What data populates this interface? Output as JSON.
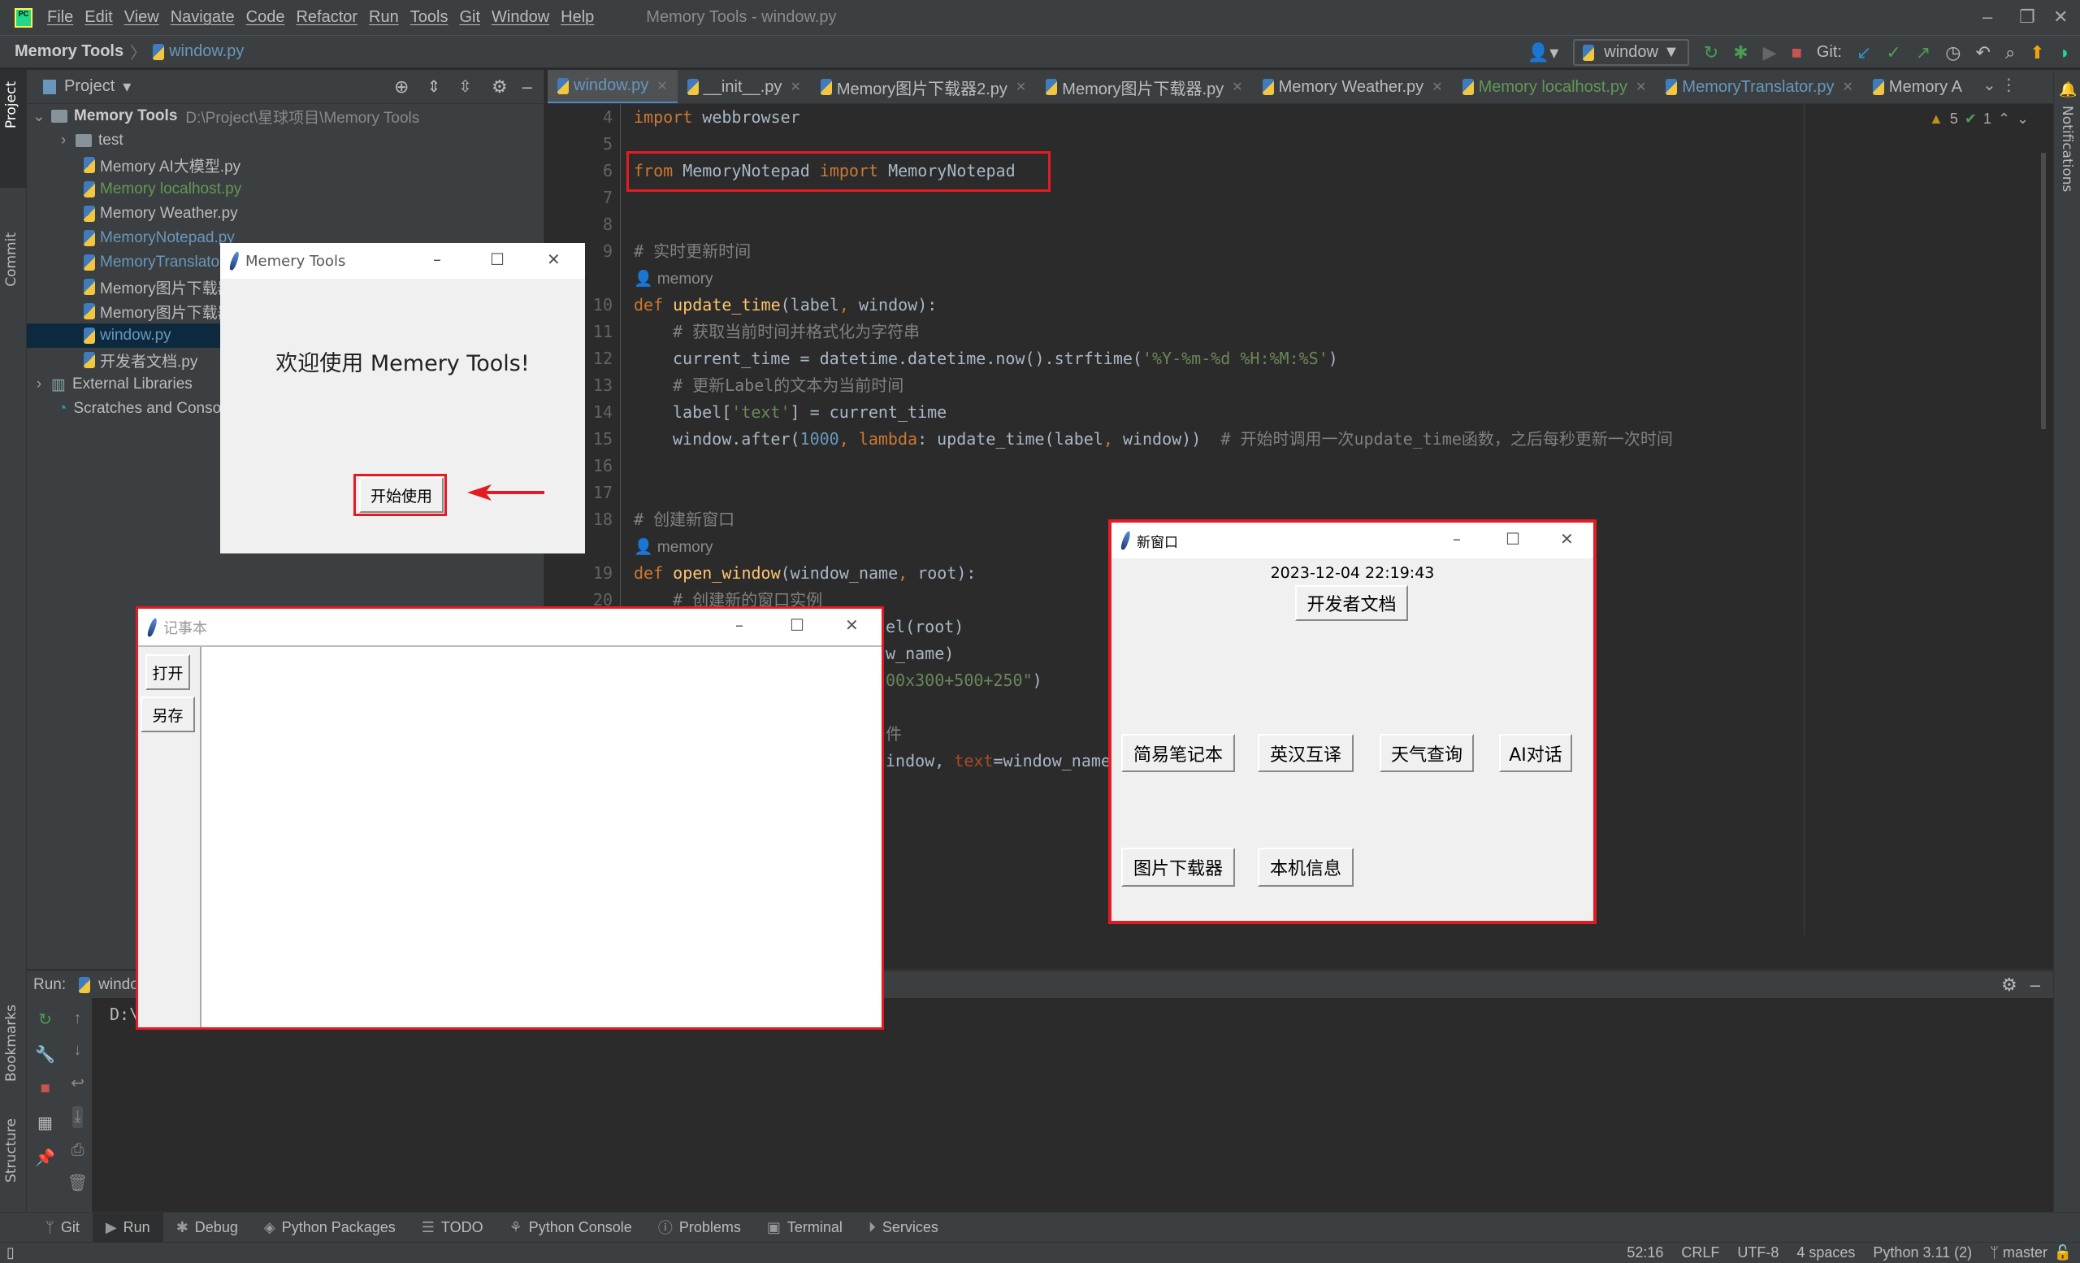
{
  "app": {
    "title": "Memory Tools - window.py",
    "menu": [
      "File",
      "Edit",
      "View",
      "Navigate",
      "Code",
      "Refactor",
      "Run",
      "Tools",
      "Git",
      "Window",
      "Help"
    ]
  },
  "breadcrumb": {
    "project": "Memory Tools",
    "file": "window.py"
  },
  "toolbar": {
    "run_config": "window",
    "git_label": "Git:"
  },
  "project_panel": {
    "title": "Project",
    "root": {
      "name": "Memory Tools",
      "path": "D:\\Project\\星球项目\\Memory Tools"
    },
    "items": [
      {
        "label": "test",
        "type": "folder",
        "color": "#bbbbbb"
      },
      {
        "label": "Memory AI大模型.py",
        "type": "file",
        "color": "#bbbbbb"
      },
      {
        "label": "Memory localhost.py",
        "type": "file",
        "color": "#629755"
      },
      {
        "label": "Memory Weather.py",
        "type": "file",
        "color": "#bbbbbb"
      },
      {
        "label": "MemoryNotepad.py",
        "type": "file",
        "color": "#6897bb"
      },
      {
        "label": "MemoryTranslator.py",
        "type": "file",
        "color": "#6897bb"
      },
      {
        "label": "Memory图片下载器2.py",
        "type": "file",
        "color": "#bbbbbb"
      },
      {
        "label": "Memory图片下载器.py",
        "type": "file",
        "color": "#bbbbbb"
      },
      {
        "label": "window.py",
        "type": "file",
        "color": "#6897bb",
        "selected": true
      },
      {
        "label": "开发者文档.py",
        "type": "file",
        "color": "#bbbbbb"
      },
      {
        "label": "External Libraries",
        "type": "lib",
        "color": "#bbbbbb"
      },
      {
        "label": "Scratches and Consoles",
        "type": "scratch",
        "color": "#bbbbbb"
      }
    ]
  },
  "editor_tabs": [
    {
      "label": "window.py",
      "color": "#6897bb",
      "active": true
    },
    {
      "label": "__init__.py",
      "color": "#bbbbbb"
    },
    {
      "label": "Memory图片下载器2.py",
      "color": "#bbbbbb"
    },
    {
      "label": "Memory图片下载器.py",
      "color": "#bbbbbb"
    },
    {
      "label": "Memory Weather.py",
      "color": "#bbbbbb"
    },
    {
      "label": "Memory localhost.py",
      "color": "#629755"
    },
    {
      "label": "MemoryTranslator.py",
      "color": "#6897bb"
    },
    {
      "label": "Memory A",
      "color": "#bbbbbb"
    }
  ],
  "inspections": {
    "warnings": "5",
    "ok": "1"
  },
  "code": [
    {
      "n": "4",
      "indent": 0,
      "tokens": [
        {
          "t": "import ",
          "k": "kw"
        },
        {
          "t": "webbrowser",
          "k": ""
        }
      ]
    },
    {
      "n": "5",
      "indent": 0,
      "tokens": []
    },
    {
      "n": "6",
      "indent": 0,
      "tokens": [
        {
          "t": "from ",
          "k": "kw"
        },
        {
          "t": "MemoryNotepad ",
          "k": ""
        },
        {
          "t": "import ",
          "k": "kw"
        },
        {
          "t": "MemoryNotepad",
          "k": ""
        }
      ]
    },
    {
      "n": "7",
      "indent": 0,
      "tokens": []
    },
    {
      "n": "8",
      "indent": 0,
      "tokens": []
    },
    {
      "n": "9",
      "indent": 0,
      "tokens": [
        {
          "t": "# 实时更新时间",
          "k": "cmt"
        }
      ]
    },
    {
      "n": "",
      "indent": 0,
      "tokens": [
        {
          "t": "👤 memory",
          "k": "inlay"
        }
      ]
    },
    {
      "n": "10",
      "indent": 0,
      "tokens": [
        {
          "t": "def ",
          "k": "kw"
        },
        {
          "t": "update_time",
          "k": "fn"
        },
        {
          "t": "(label",
          "k": ""
        },
        {
          "t": ", ",
          "k": "kw"
        },
        {
          "t": "window):",
          "k": ""
        }
      ]
    },
    {
      "n": "11",
      "indent": 1,
      "tokens": [
        {
          "t": "# 获取当前时间并格式化为字符串",
          "k": "cmt"
        }
      ]
    },
    {
      "n": "12",
      "indent": 1,
      "tokens": [
        {
          "t": "current_time = datetime.datetime.now().strftime(",
          "k": ""
        },
        {
          "t": "'%Y-%m-%d %H:%M:%S'",
          "k": "str"
        },
        {
          "t": ")",
          "k": ""
        }
      ]
    },
    {
      "n": "13",
      "indent": 1,
      "tokens": [
        {
          "t": "# 更新Label的文本为当前时间",
          "k": "cmt"
        }
      ]
    },
    {
      "n": "14",
      "indent": 1,
      "tokens": [
        {
          "t": "label[",
          "k": ""
        },
        {
          "t": "'text'",
          "k": "str"
        },
        {
          "t": "] = current_time",
          "k": ""
        }
      ]
    },
    {
      "n": "15",
      "indent": 1,
      "tokens": [
        {
          "t": "window.after(",
          "k": ""
        },
        {
          "t": "1000",
          "k": "num"
        },
        {
          "t": ", ",
          "k": "kw"
        },
        {
          "t": "lambda",
          "k": "kw"
        },
        {
          "t": ": update_time(label",
          "k": ""
        },
        {
          "t": ", ",
          "k": "kw"
        },
        {
          "t": "window))  ",
          "k": ""
        },
        {
          "t": "# 开始时调用一次update_time函数，之后每秒更新一次时间",
          "k": "cmt"
        }
      ]
    },
    {
      "n": "16",
      "indent": 0,
      "tokens": []
    },
    {
      "n": "17",
      "indent": 0,
      "tokens": []
    },
    {
      "n": "18",
      "indent": 0,
      "tokens": [
        {
          "t": "# 创建新窗口",
          "k": "cmt"
        }
      ]
    },
    {
      "n": "",
      "indent": 0,
      "tokens": [
        {
          "t": "👤 memory",
          "k": "inlay"
        }
      ]
    },
    {
      "n": "19",
      "indent": 0,
      "tokens": [
        {
          "t": "def ",
          "k": "kw"
        },
        {
          "t": "open_window",
          "k": "fn"
        },
        {
          "t": "(window_name",
          "k": ""
        },
        {
          "t": ", ",
          "k": "kw"
        },
        {
          "t": "root):",
          "k": ""
        }
      ]
    },
    {
      "n": "20",
      "indent": 1,
      "tokens": [
        {
          "t": "# 创建新的窗口实例",
          "k": "cmt"
        }
      ]
    },
    {
      "n": "21",
      "indent": 0,
      "frag": true,
      "tokens": [
        {
          "t": "el(root)",
          "k": ""
        }
      ]
    },
    {
      "n": "22",
      "indent": 0,
      "frag": true,
      "tokens": [
        {
          "t": "w_name)",
          "k": ""
        }
      ]
    },
    {
      "n": "23",
      "indent": 0,
      "frag": true,
      "tokens": [
        {
          "t": "00x300+500+250\"",
          "k": "str"
        },
        {
          "t": ")",
          "k": ""
        }
      ]
    },
    {
      "n": "24",
      "indent": 0,
      "tokens": []
    },
    {
      "n": "25",
      "indent": 0,
      "frag": true,
      "tokens": [
        {
          "t": "件",
          "k": "cmt"
        }
      ]
    },
    {
      "n": "26",
      "indent": 0,
      "frag": true,
      "tokens": [
        {
          "t": "indow, ",
          "k": ""
        },
        {
          "t": "text",
          "k": "param"
        },
        {
          "t": "=window_name",
          "k": ""
        }
      ]
    }
  ],
  "run_panel": {
    "label": "Run:",
    "tab": "window",
    "console": "D:\\"
  },
  "left_stripe": {
    "project": "Project",
    "commit": "Commit",
    "bookmarks": "Bookmarks",
    "structure": "Structure"
  },
  "right_stripe": {
    "notifications": "Notifications"
  },
  "bottom_tabs": [
    "Git",
    "Run",
    "Debug",
    "Python Packages",
    "TODO",
    "Python Console",
    "Problems",
    "Terminal",
    "Services"
  ],
  "status": {
    "position": "52:16",
    "line_sep": "CRLF",
    "encoding": "UTF-8",
    "indent": "4 spaces",
    "interpreter": "Python 3.11 (2)",
    "branch": "master"
  },
  "memory_tools_window": {
    "title": "Memery Tools",
    "welcome": "欢迎使用 Memery Tools!",
    "start_button": "开始使用"
  },
  "notepad_window": {
    "title": "记事本",
    "open_button": "打开",
    "save_as_button": "另存"
  },
  "new_window": {
    "title": "新窗口",
    "time": "2023-12-04 22:19:43",
    "docs_button": "开发者文档",
    "buttons": [
      "简易笔记本",
      "英汉互译",
      "天气查询",
      "AI对话",
      "图片下载器",
      "本机信息"
    ]
  },
  "colors": {
    "highlight": "#e51b23",
    "accent": "#4a88c7"
  }
}
